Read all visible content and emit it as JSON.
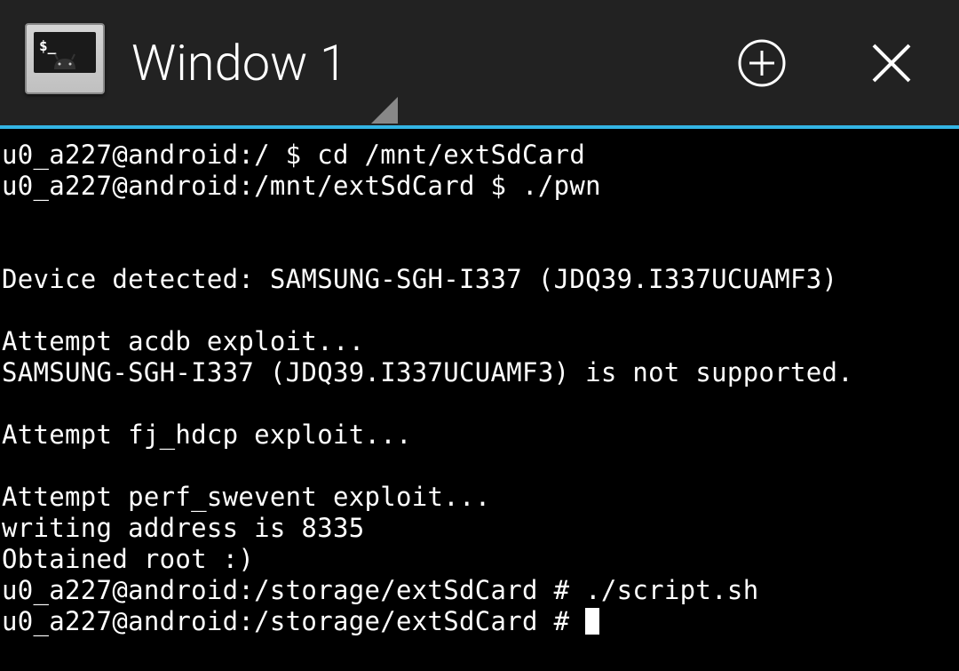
{
  "header": {
    "title": "Window 1",
    "icons": {
      "terminal": "terminal-app-icon",
      "plus": "plus-icon",
      "close": "close-icon"
    }
  },
  "terminal": {
    "lines": [
      "u0_a227@android:/ $ cd /mnt/extSdCard",
      "u0_a227@android:/mnt/extSdCard $ ./pwn",
      "",
      "",
      "Device detected: SAMSUNG-SGH-I337 (JDQ39.I337UCUAMF3)",
      "",
      "Attempt acdb exploit...",
      "SAMSUNG-SGH-I337 (JDQ39.I337UCUAMF3) is not supported.",
      "",
      "Attempt fj_hdcp exploit...",
      "",
      "Attempt perf_swevent exploit...",
      "writing address is 8335",
      "Obtained root :)",
      "u0_a227@android:/storage/extSdCard # ./script.sh",
      "u0_a227@android:/storage/extSdCard # "
    ]
  }
}
